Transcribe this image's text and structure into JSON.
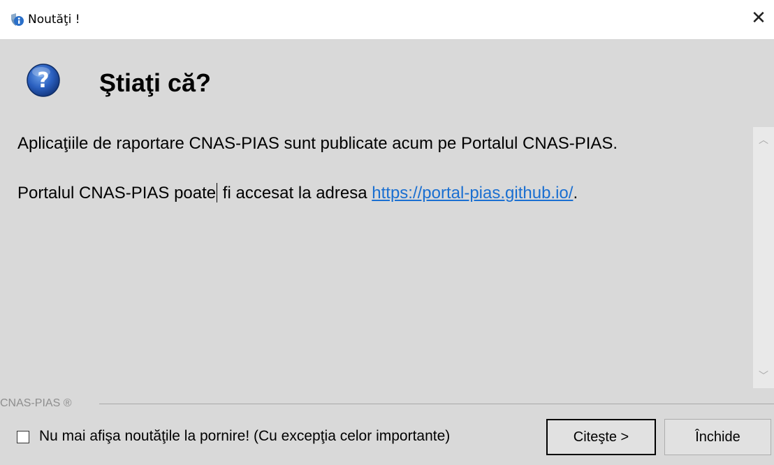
{
  "window": {
    "title": "Noutăţi !",
    "close_glyph": "✕"
  },
  "header": {
    "title": "Ştiaţi că?"
  },
  "content": {
    "paragraph1": "Aplicaţiile de raportare CNAS-PIAS sunt publicate acum pe Portalul CNAS-PIAS.",
    "paragraph2_before_caret": "Portalul CNAS-PIAS poate",
    "paragraph2_after_caret": " fi accesat la adresa ",
    "link_text": "https://portal-pias.github.io/",
    "paragraph2_suffix": "."
  },
  "scrollbar": {
    "up_glyph": "︿",
    "down_glyph": "﹀"
  },
  "footer": {
    "group_label": "CNAS-PIAS ®",
    "checkbox_label": "Nu mai afişa noutăţile la pornire! (Cu excepţia celor importante)",
    "checkbox_checked": false,
    "read_button": "Citeşte >",
    "close_button": "Închide"
  },
  "icons": {
    "title": "info-shield-icon",
    "header": "question-icon"
  },
  "colors": {
    "client_bg": "#d9d9d9",
    "link": "#1a6fd1",
    "button_bg": "#e1e1e1"
  }
}
